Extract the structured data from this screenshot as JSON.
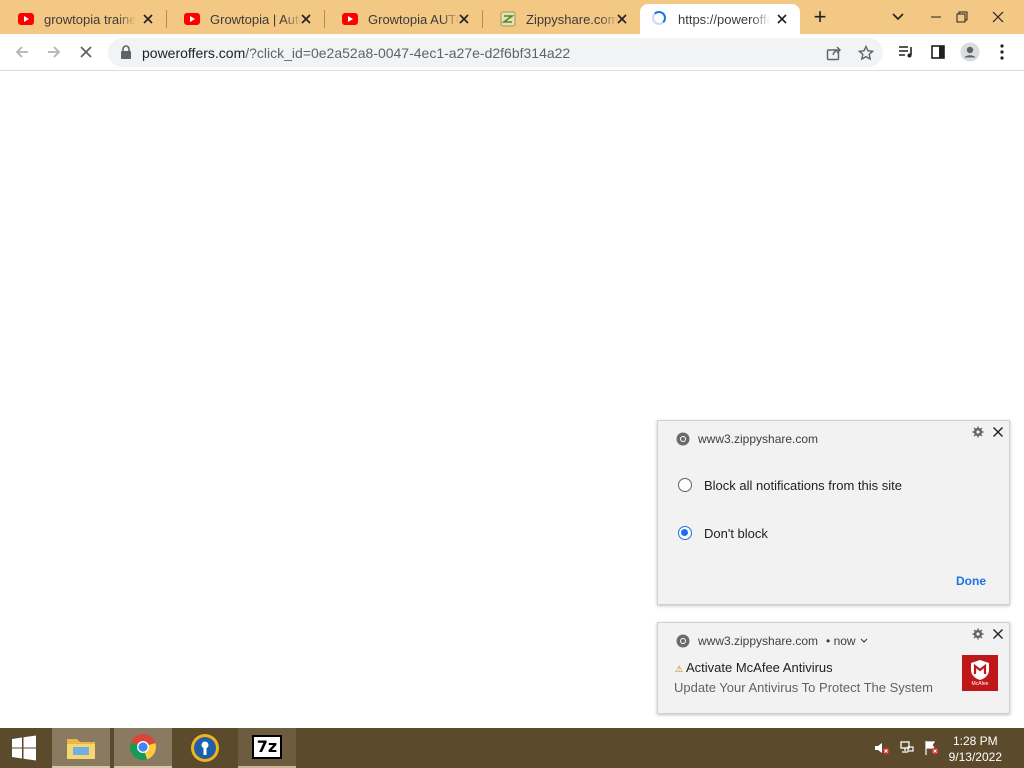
{
  "browser": {
    "tabs": [
      {
        "title": "growtopia trainer",
        "favicon": "youtube-icon",
        "active": false
      },
      {
        "title": "Growtopia | Auto",
        "favicon": "youtube-icon",
        "active": false
      },
      {
        "title": "Growtopia AUTO",
        "favicon": "youtube-icon",
        "active": false
      },
      {
        "title": "Zippyshare.com -",
        "favicon": "zippyshare-icon",
        "active": false
      },
      {
        "title": "https://poweroffe",
        "favicon": "loading-spinner-icon",
        "active": true
      }
    ],
    "new_tab_label": "+",
    "address_bar": {
      "domain": "poweroffers.com",
      "path": "/?click_id=0e2a52a8-0047-4ec1-a27e-d2f6bf314a22"
    }
  },
  "notifications": [
    {
      "origin": "www3.zippyshare.com",
      "options": [
        {
          "label": "Block all notifications from this site",
          "checked": false
        },
        {
          "label": "Don't block",
          "checked": true
        }
      ],
      "done_label": "Done"
    },
    {
      "origin": "www3.zippyshare.com",
      "time": "• now",
      "title": "Activate McAfee Antivirus",
      "warning_glyph": "⚠",
      "body": "Update Your Antivirus To Protect The System",
      "image_text": "McAfee"
    }
  ],
  "taskbar": {
    "apps": [
      "start-icon",
      "file-explorer-icon",
      "chrome-icon",
      "password-manager-icon",
      "7zip-icon"
    ],
    "sevenzip_label": "7z",
    "clock": {
      "time": "1:28 PM",
      "date": "9/13/2022"
    }
  },
  "colors": {
    "tabstrip": "#f3c784",
    "taskbar": "#5c4a2c",
    "accent": "#1a73e8",
    "mcafee": "#c01818"
  }
}
